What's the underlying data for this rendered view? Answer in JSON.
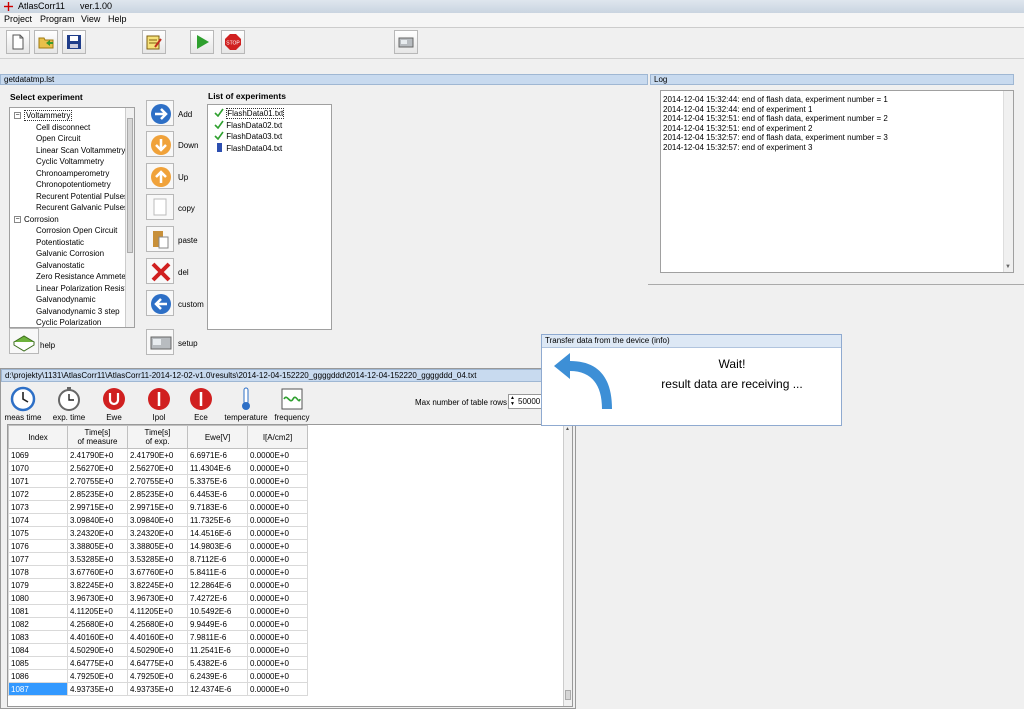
{
  "app": {
    "title": "AtlasCorr11",
    "version": "ver.1.00"
  },
  "menu": [
    "Project",
    "Program",
    "View",
    "Help"
  ],
  "toolbar": {
    "buttons": [
      "new-file-icon",
      "open-folder-icon",
      "save-icon",
      "edit-icon",
      "play-icon",
      "stop-icon",
      "device-icon"
    ],
    "stop_label": "STOP"
  },
  "experiments_panel": {
    "title": "getdatatmp.lst",
    "select_label": "Select experiment",
    "list_label": "List of experiments",
    "tree": [
      {
        "label": "Voltammetry",
        "group": true
      },
      {
        "label": "Cell disconnect"
      },
      {
        "label": "Open Circuit"
      },
      {
        "label": "Linear Scan Voltammetry"
      },
      {
        "label": "Cyclic Voltammetry"
      },
      {
        "label": "Chronoamperometry"
      },
      {
        "label": "Chronopotentiometry"
      },
      {
        "label": "Recurent Potential Pulses"
      },
      {
        "label": "Recurent Galvanic Pulses"
      },
      {
        "label": "Corrosion",
        "group": true
      },
      {
        "label": "Corrosion Open Circuit"
      },
      {
        "label": "Potentiostatic"
      },
      {
        "label": "Galvanic Corrosion"
      },
      {
        "label": "Galvanostatic"
      },
      {
        "label": "Zero Resistance Ammeter"
      },
      {
        "label": "Linear Polarization Resista"
      },
      {
        "label": "Galvanodynamic"
      },
      {
        "label": "Galvanodynamic 3 step"
      },
      {
        "label": "Cyclic Polarization"
      }
    ],
    "buttons": [
      "Add",
      "Down",
      "Up",
      "copy",
      "paste",
      "del",
      "custom",
      "setup"
    ],
    "help_label": "help",
    "experiments": [
      {
        "name": "FlashData01.txt",
        "status": "done"
      },
      {
        "name": "FlashData02.txt",
        "status": "done"
      },
      {
        "name": "FlashData03.txt",
        "status": "done"
      },
      {
        "name": "FlashData04.txt",
        "status": "running"
      }
    ]
  },
  "log": {
    "title": "Log",
    "lines": [
      "2014-12-04 15:32:44: end of flash data, experiment number = 1",
      "2014-12-04 15:32:44: end of experiment 1",
      "2014-12-04 15:32:51: end of flash data, experiment number = 2",
      "2014-12-04 15:32:51: end of experiment 2",
      "2014-12-04 15:32:57: end of flash data, experiment number = 3",
      "2014-12-04 15:32:57: end of experiment 3"
    ]
  },
  "transfer_dialog": {
    "title": "Transfer data from the device (info)",
    "line1": "Wait!",
    "line2": "result data are receiving ..."
  },
  "results": {
    "path": "d:\\projekty\\1131\\AtlasCorr11\\AtlasCorr11-2014-12-02-v1.0\\results\\2014-12-04-152220_ggggddd\\2014-12-04-152220_ggggddd_04.txt",
    "tools": [
      "meas time",
      "exp. time",
      "Ewe",
      "Ipol",
      "Ece",
      "temperature",
      "frequency"
    ],
    "max_rows_label": "Max number of table rows",
    "max_rows_value": "50000",
    "columns": [
      {
        "line1": "Index",
        "line2": ""
      },
      {
        "line1": "Time[s]",
        "line2": "of measure"
      },
      {
        "line1": "Time[s]",
        "line2": "of exp."
      },
      {
        "line1": "Ewe[V]",
        "line2": ""
      },
      {
        "line1": "I[A/cm2]",
        "line2": ""
      }
    ],
    "rows": [
      [
        "1069",
        "2.41790E+0",
        "2.41790E+0",
        "6.6971E-6",
        "0.0000E+0"
      ],
      [
        "1070",
        "2.56270E+0",
        "2.56270E+0",
        "11.4304E-6",
        "0.0000E+0"
      ],
      [
        "1071",
        "2.70755E+0",
        "2.70755E+0",
        "5.3375E-6",
        "0.0000E+0"
      ],
      [
        "1072",
        "2.85235E+0",
        "2.85235E+0",
        "6.4453E-6",
        "0.0000E+0"
      ],
      [
        "1073",
        "2.99715E+0",
        "2.99715E+0",
        "9.7183E-6",
        "0.0000E+0"
      ],
      [
        "1074",
        "3.09840E+0",
        "3.09840E+0",
        "11.7325E-6",
        "0.0000E+0"
      ],
      [
        "1075",
        "3.24320E+0",
        "3.24320E+0",
        "14.4516E-6",
        "0.0000E+0"
      ],
      [
        "1076",
        "3.38805E+0",
        "3.38805E+0",
        "14.9803E-6",
        "0.0000E+0"
      ],
      [
        "1077",
        "3.53285E+0",
        "3.53285E+0",
        "8.7112E-6",
        "0.0000E+0"
      ],
      [
        "1078",
        "3.67760E+0",
        "3.67760E+0",
        "5.8411E-6",
        "0.0000E+0"
      ],
      [
        "1079",
        "3.82245E+0",
        "3.82245E+0",
        "12.2864E-6",
        "0.0000E+0"
      ],
      [
        "1080",
        "3.96730E+0",
        "3.96730E+0",
        "7.4272E-6",
        "0.0000E+0"
      ],
      [
        "1081",
        "4.11205E+0",
        "4.11205E+0",
        "10.5492E-6",
        "0.0000E+0"
      ],
      [
        "1082",
        "4.25680E+0",
        "4.25680E+0",
        "9.9449E-6",
        "0.0000E+0"
      ],
      [
        "1083",
        "4.40160E+0",
        "4.40160E+0",
        "7.9811E-6",
        "0.0000E+0"
      ],
      [
        "1084",
        "4.50290E+0",
        "4.50290E+0",
        "11.2541E-6",
        "0.0000E+0"
      ],
      [
        "1085",
        "4.64775E+0",
        "4.64775E+0",
        "5.4382E-6",
        "0.0000E+0"
      ],
      [
        "1086",
        "4.79250E+0",
        "4.79250E+0",
        "6.2439E-6",
        "0.0000E+0"
      ],
      [
        "1087",
        "4.93735E+0",
        "4.93735E+0",
        "12.4374E-6",
        "0.0000E+0"
      ]
    ],
    "selected_row": "1087"
  },
  "colors": {
    "panel_header": "#c8daef",
    "selection": "#3399ff",
    "stop": "#d02020",
    "play": "#2fa02f"
  }
}
